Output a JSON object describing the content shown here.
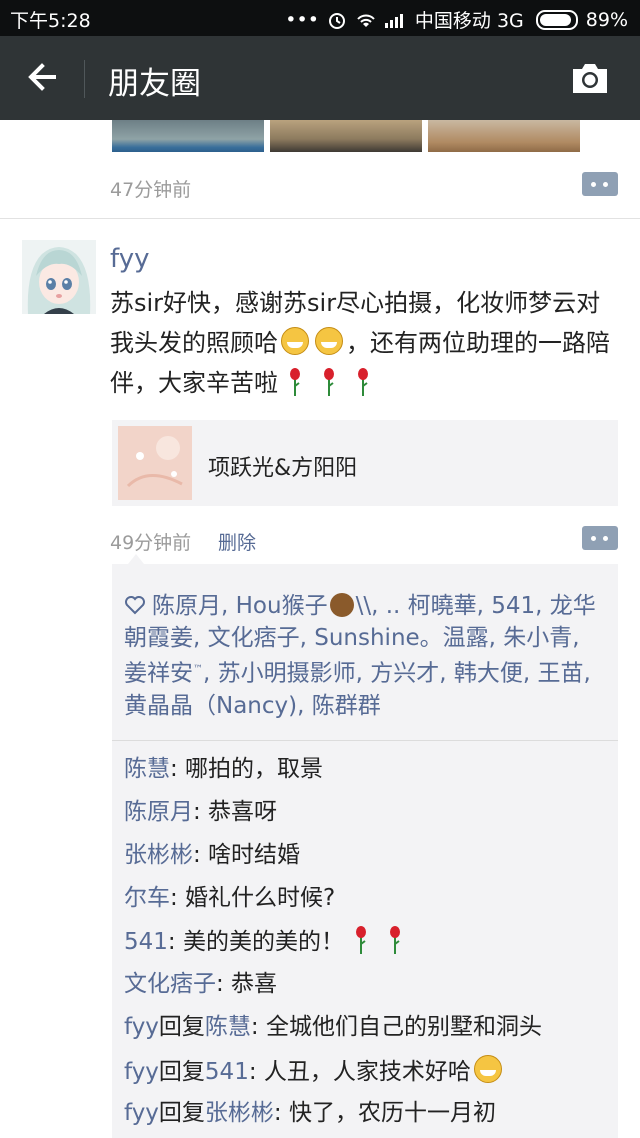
{
  "status": {
    "time": "下午5:28",
    "dots": "•••",
    "carrier": "中国移动 3G",
    "battery": "89%"
  },
  "nav": {
    "title": "朋友圈"
  },
  "prev_post": {
    "time": "47分钟前"
  },
  "post": {
    "user": "fyy",
    "text1": "苏sir好快，感谢苏sir尽心拍摄，化妆师梦云对我头发的照顾哈",
    "text2": "，还有两位助理的一路陪伴，大家辛苦啦",
    "link_title": "项跃光&方阳阳",
    "time": "49分钟前",
    "delete_label": "删除"
  },
  "likes": {
    "text_a": "陈原月, Hou猴子",
    "text_b": "\\\\, .. 柯曉華, 541, 龙华朝霞姜, 文化痞子, Sunshine。温露, 朱小青, 姜祥安",
    "tm": "™",
    "text_c": ", 苏小明摄影师, 方兴才, 韩大便, 王苗, 黄晶晶（Nancy), 陈群群"
  },
  "comments": [
    {
      "author": "陈慧",
      "text": ": 哪拍的，取景"
    },
    {
      "author": "陈原月",
      "text": ": 恭喜呀"
    },
    {
      "author": "张彬彬",
      "text": ": 啥时结婚"
    },
    {
      "author": "尔车",
      "text": ": 婚礼什么时候?"
    },
    {
      "author": "541",
      "text": ": 美的美的美的！"
    },
    {
      "author": "文化痞子",
      "text": ": 恭喜"
    },
    {
      "author": "fyy",
      "reply_word": "回复",
      "target": "陈慧",
      "text": ": 全城他们自己的别墅和洞头"
    },
    {
      "author": "fyy",
      "reply_word": "回复",
      "target": "541",
      "text": ": 人丑，人家技术好哈"
    },
    {
      "author": "fyy",
      "reply_word": "回复",
      "target": "张彬彬",
      "text": ": 快了，农历十一月初"
    }
  ],
  "icons": {
    "back": "arrow-left-icon",
    "camera": "camera-icon",
    "more": "more-dots-icon",
    "heart": "heart-icon",
    "emoji": "grin-emoji-icon",
    "rose": "rose-emoji-icon",
    "monkey": "monkey-emoji-icon"
  },
  "colors": {
    "nav_bg": "#2f3436",
    "status_bg": "#0d0f10",
    "link_blue": "#576b95",
    "gray_text": "#9b9b9b",
    "comment_bg": "#f3f3f5"
  }
}
